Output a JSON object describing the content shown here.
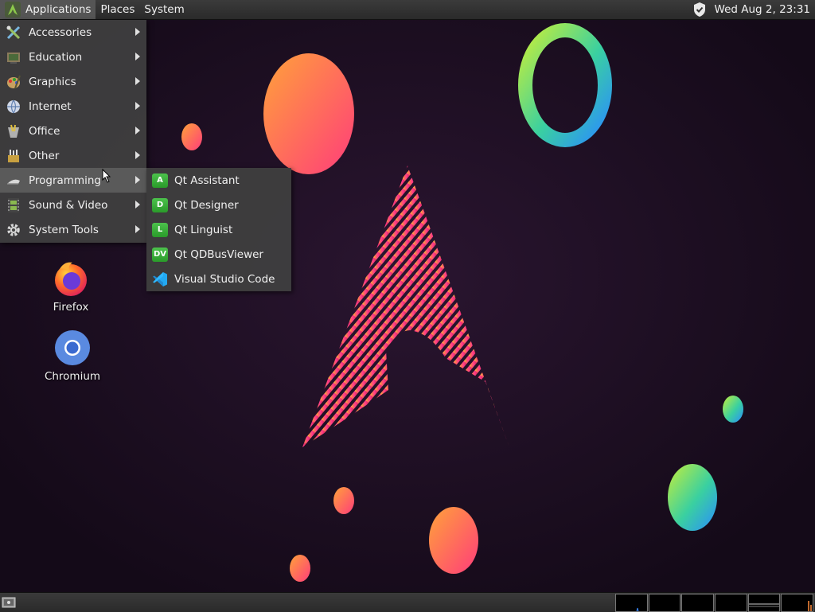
{
  "top_panel": {
    "applications": "Applications",
    "places": "Places",
    "system": "System",
    "clock": "Wed Aug  2, 23:31"
  },
  "app_menu": {
    "items": [
      {
        "label": "Accessories",
        "icon": "accessories-icon"
      },
      {
        "label": "Education",
        "icon": "education-icon"
      },
      {
        "label": "Graphics",
        "icon": "graphics-icon"
      },
      {
        "label": "Internet",
        "icon": "internet-icon"
      },
      {
        "label": "Office",
        "icon": "office-icon"
      },
      {
        "label": "Other",
        "icon": "other-icon"
      },
      {
        "label": "Programming",
        "icon": "programming-icon"
      },
      {
        "label": "Sound & Video",
        "icon": "sound-video-icon"
      },
      {
        "label": "System Tools",
        "icon": "system-tools-icon"
      }
    ],
    "highlighted": "Programming"
  },
  "programming_submenu": {
    "items": [
      {
        "label": "Qt Assistant",
        "badge": "A"
      },
      {
        "label": "Qt Designer",
        "badge": "D"
      },
      {
        "label": "Qt Linguist",
        "badge": "L"
      },
      {
        "label": "Qt QDBusViewer",
        "badge": "DV"
      },
      {
        "label": "Visual Studio Code",
        "badge": ""
      }
    ]
  },
  "desktop_icons": [
    {
      "label": "Firefox",
      "icon": "firefox-icon"
    },
    {
      "label": "Chromium",
      "icon": "chromium-icon"
    }
  ],
  "colors": {
    "wallpaper_bg": "#1a0f1e",
    "panel_bg": "#2e2e2e",
    "menu_bg": "#404040",
    "qt_green": "#3aae3a",
    "vscode_blue": "#23a9f2"
  }
}
